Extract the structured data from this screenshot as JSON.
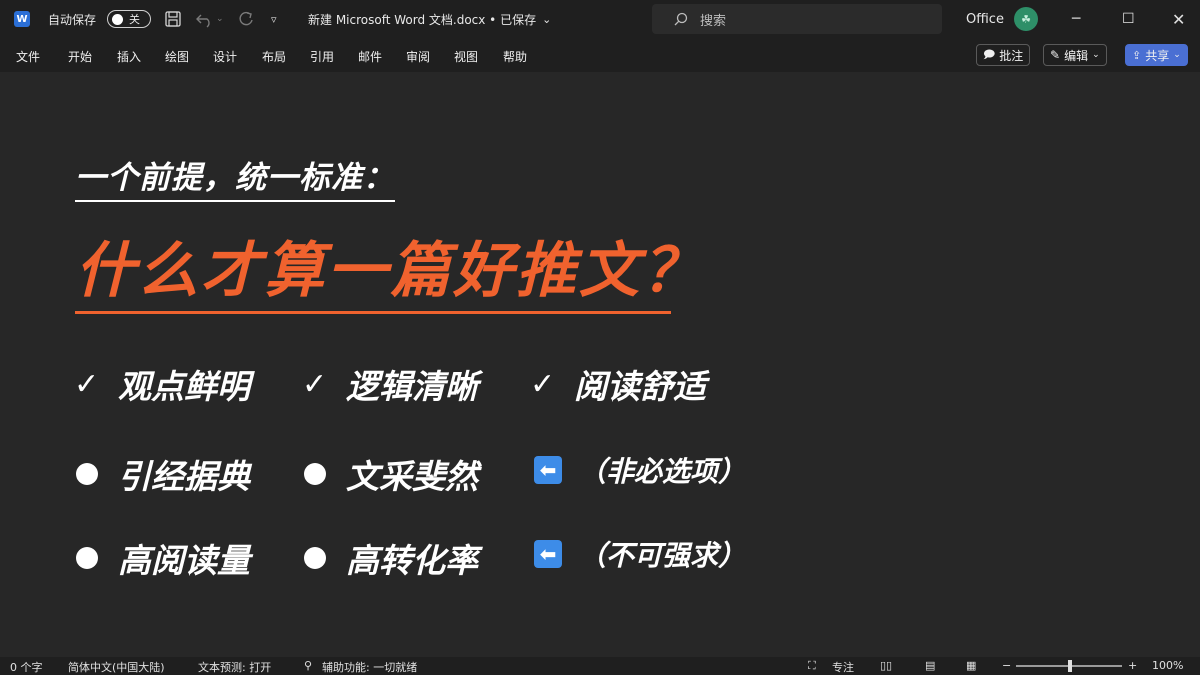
{
  "titlebar": {
    "app_icon": "word-icon",
    "app_icon_letter": "W",
    "autosave_label": "自动保存",
    "autosave_state": "关",
    "doc_title": "新建 Microsoft Word 文档.docx • 已保存",
    "search_placeholder": "搜索",
    "office_label": "Office",
    "avatar_glyph": "☘"
  },
  "menu": {
    "tabs": [
      "文件",
      "开始",
      "插入",
      "绘图",
      "设计",
      "布局",
      "引用",
      "邮件",
      "审阅",
      "视图",
      "帮助"
    ],
    "comment_label": "批注",
    "edit_label": "编辑",
    "share_label": "共享"
  },
  "document": {
    "subtitle": "一个前提，统一标准：",
    "headline": "什么才算一篇好推文？",
    "checks": [
      "观点鲜明",
      "逻辑清晰",
      "阅读舒适"
    ],
    "row2": [
      "引经据典",
      "文采斐然"
    ],
    "row2_note": "（非必选项）",
    "row3": [
      "高阅读量",
      "高转化率"
    ],
    "row3_note": "（不可强求）",
    "colors": {
      "accent": "#f0622e",
      "background": "#272727",
      "arrow_box": "#3d8ce8"
    }
  },
  "statusbar": {
    "word_count": "0 个字",
    "language": "简体中文(中国大陆)",
    "text_prediction": "文本预测: 打开",
    "accessibility": "辅助功能: 一切就绪",
    "focus_label": "专注",
    "zoom_value": "100%"
  }
}
